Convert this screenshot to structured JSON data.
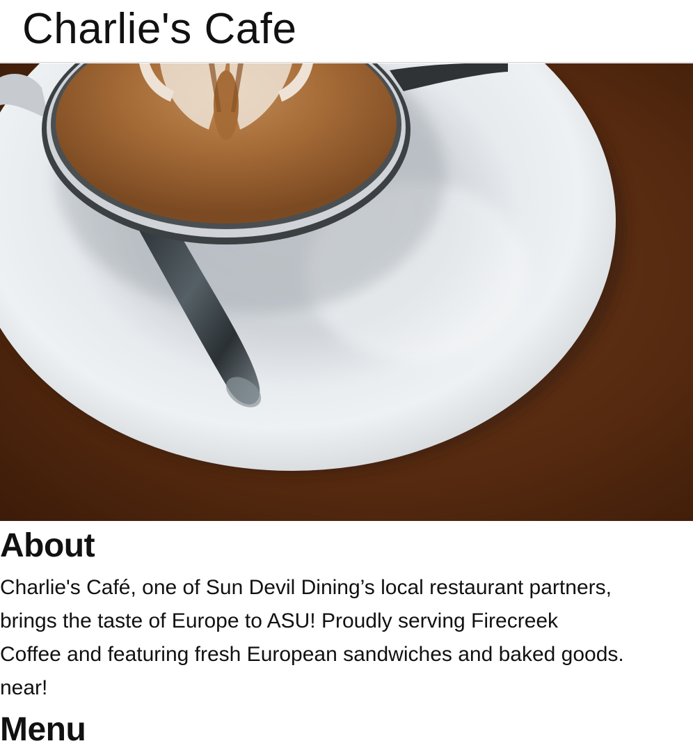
{
  "header": {
    "title": "Charlie's Cafe"
  },
  "hero": {
    "image": "latte-art-coffee-cup-on-saucer"
  },
  "about": {
    "heading": "About",
    "lines": [
      "Charlie's Café, one of Sun Devil Dining’s local restaurant partners,",
      "brings the taste of Europe to ASU! Proudly serving Firecreek",
      "Coffee and featuring fresh European sandwiches and baked goods.",
      "near!"
    ]
  },
  "menu": {
    "heading": "Menu"
  },
  "colors": {
    "text": "#111111",
    "divider": "#cfcfcf",
    "table_wood": "#5a3016",
    "saucer": "#e2e6e9",
    "crema": "#a8703e"
  }
}
